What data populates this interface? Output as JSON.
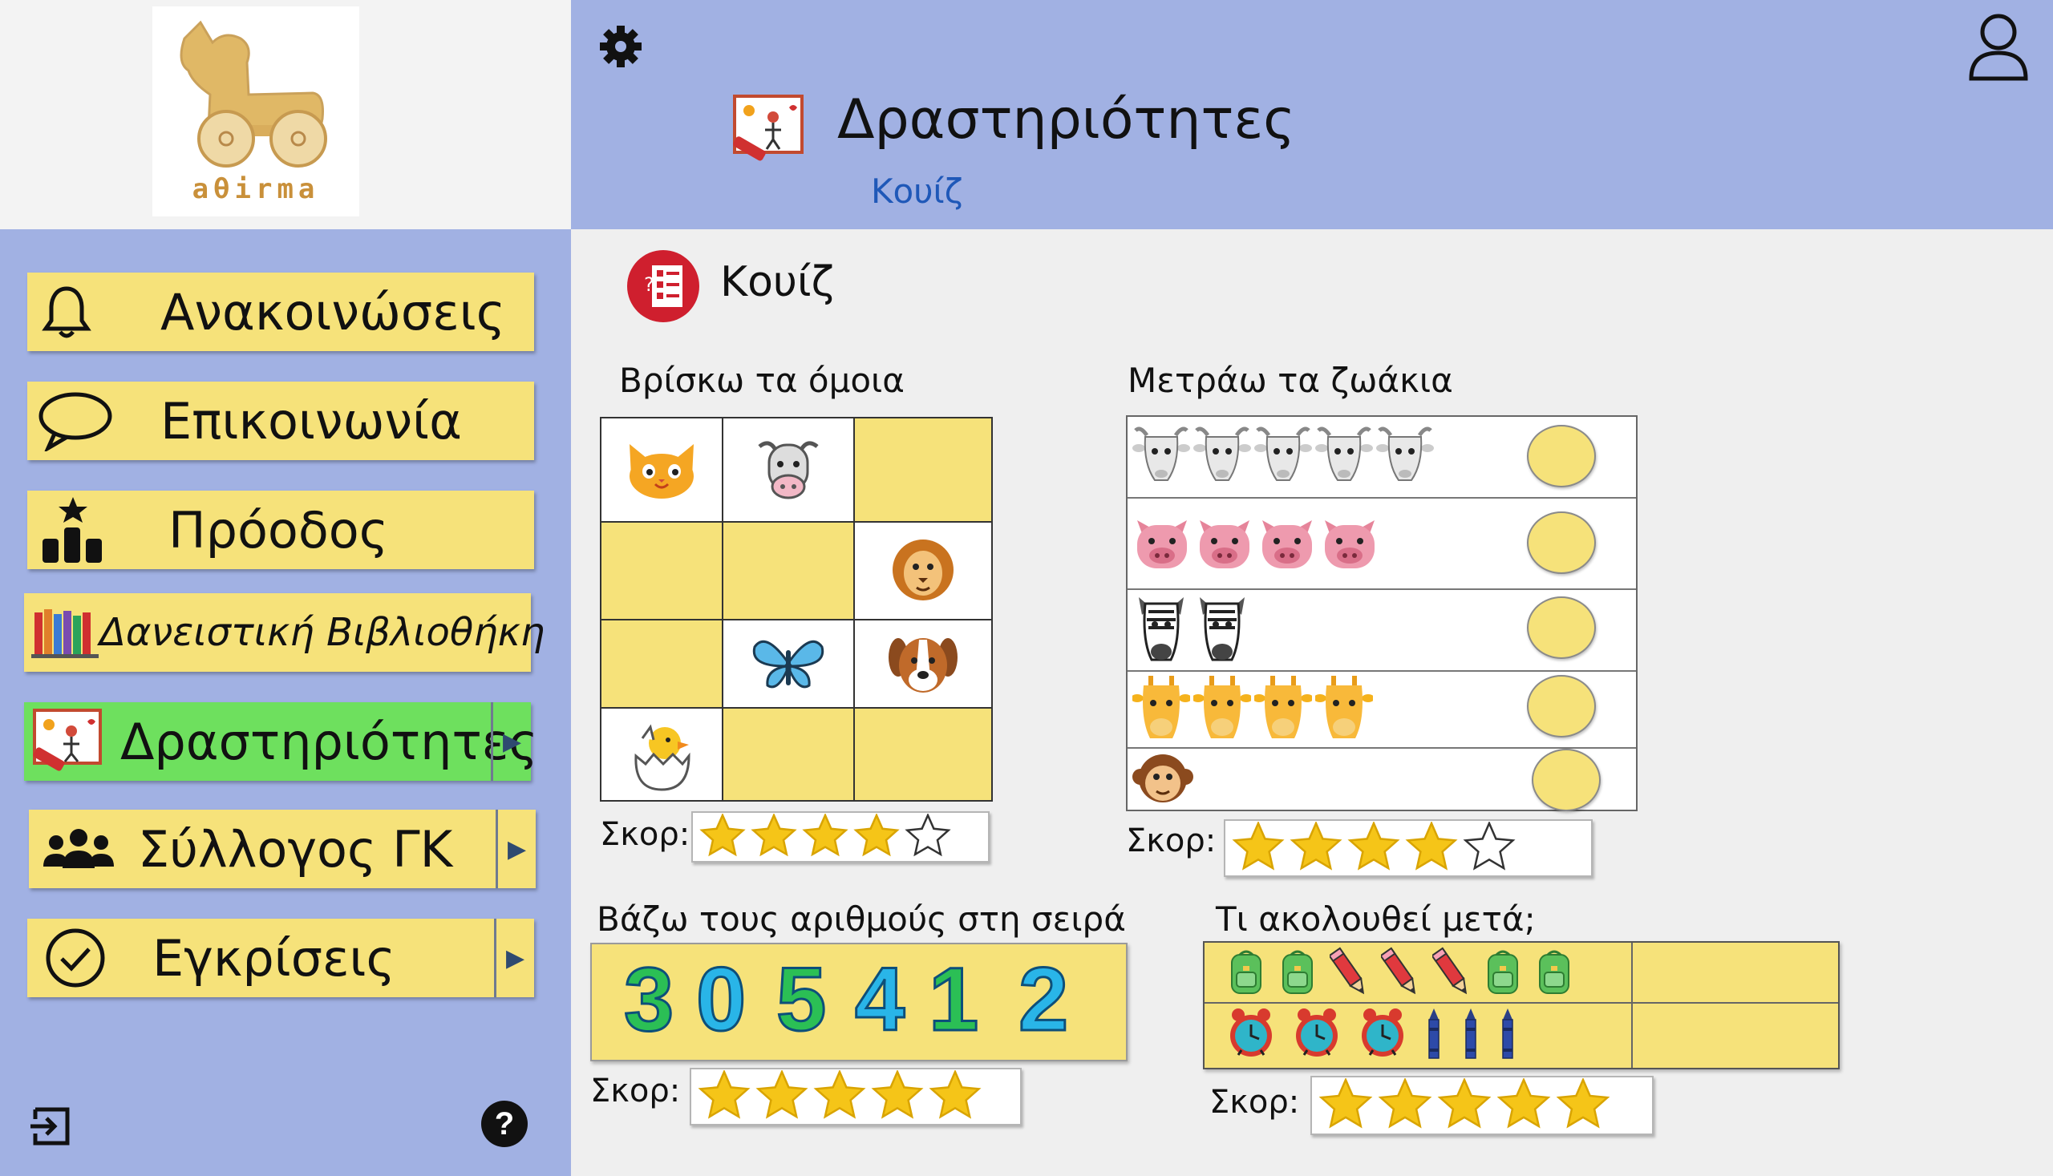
{
  "logo": {
    "wordmark": "aθirma"
  },
  "sidebar": {
    "items": [
      {
        "label": "Ανακοινώσεις",
        "icon": "bell-icon"
      },
      {
        "label": "Επικοινωνία",
        "icon": "speech-bubble-icon"
      },
      {
        "label": "Πρόοδος",
        "icon": "progress-podium-icon"
      },
      {
        "label": "Δανειστική Βιβλιοθήκη",
        "icon": "books-icon"
      },
      {
        "label": "Δραστηριότητες",
        "icon": "activities-drawing-icon",
        "active": true,
        "has_submenu": true
      },
      {
        "label": "Σύλλογος ΓΚ",
        "icon": "group-icon",
        "has_submenu": true
      },
      {
        "label": "Εγκρίσεις",
        "icon": "check-circle-icon",
        "has_submenu": true
      }
    ],
    "footer": {
      "logout_icon": "logout-icon",
      "help_label": "?"
    }
  },
  "header": {
    "title": "Δραστηριότητες",
    "breadcrumb": "Κουίζ",
    "settings_icon": "gear-icon",
    "user_icon": "user-icon"
  },
  "main": {
    "title": "Κουίζ",
    "score_label": "Σκορ:",
    "sections": {
      "match": {
        "title": "Βρίσκω τα όμοια",
        "stars": 4,
        "max_stars": 5,
        "animals": [
          "cat",
          "cow",
          "lion",
          "butterfly",
          "dog",
          "chick"
        ]
      },
      "count": {
        "title": "Μετράω τα ζωάκια",
        "stars": 4,
        "max_stars": 5,
        "rows": [
          {
            "animal": "goat",
            "count": 5
          },
          {
            "animal": "pig",
            "count": 4
          },
          {
            "animal": "zebra",
            "count": 2
          },
          {
            "animal": "giraffe",
            "count": 4
          },
          {
            "animal": "monkey",
            "count": 1
          }
        ]
      },
      "order": {
        "title": "Βάζω τους αριθμούς στη σειρά",
        "stars": 5,
        "max_stars": 5,
        "digits": [
          "3",
          "0",
          "5",
          "4",
          "1",
          "2"
        ]
      },
      "next": {
        "title": "Τι ακολουθεί μετά;",
        "stars": 5,
        "max_stars": 5,
        "row1": [
          "backpack",
          "backpack",
          "pencil",
          "pencil",
          "pencil",
          "backpack",
          "backpack"
        ],
        "row2": [
          "clock",
          "clock",
          "clock",
          "crayon",
          "crayon",
          "crayon"
        ]
      }
    }
  },
  "colors": {
    "sidebar_bg": "#a1b1e3",
    "nav_bg": "#f6e27a",
    "nav_active": "#6ee05e",
    "star": "#f5c518",
    "quiz_icon": "#cf1f2e"
  }
}
